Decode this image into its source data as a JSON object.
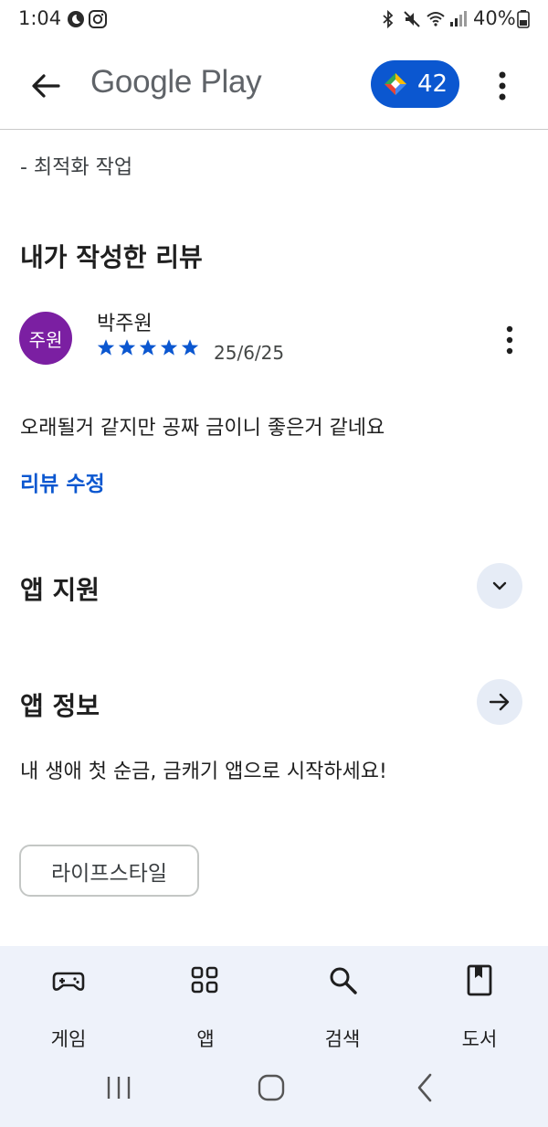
{
  "status_bar": {
    "time": "1:04",
    "battery": "40%"
  },
  "app_bar": {
    "brand": "Google Play",
    "points": "42",
    "colors": {
      "pill": "#0b57d0"
    }
  },
  "whats_new": {
    "line": "- 최적화 작업"
  },
  "review_section": {
    "title": "내가 작성한 리뷰",
    "avatar_text": "주원",
    "reviewer": "박주원",
    "rating": 5,
    "date": "25/6/25",
    "text": "오래될거 같지만 공짜 금이니 좋은거 같네요",
    "edit_label": "리뷰 수정"
  },
  "support_section": {
    "title": "앱 지원"
  },
  "info_section": {
    "title": "앱 정보",
    "description": "내 생애 첫 순금, 금캐기 앱으로 시작하세요!",
    "category": "라이프스타일"
  },
  "bottom_nav": {
    "items": [
      {
        "label": "게임",
        "icon": "gamepad-icon"
      },
      {
        "label": "앱",
        "icon": "apps-grid-icon"
      },
      {
        "label": "검색",
        "icon": "search-icon"
      },
      {
        "label": "도서",
        "icon": "book-icon"
      }
    ]
  }
}
